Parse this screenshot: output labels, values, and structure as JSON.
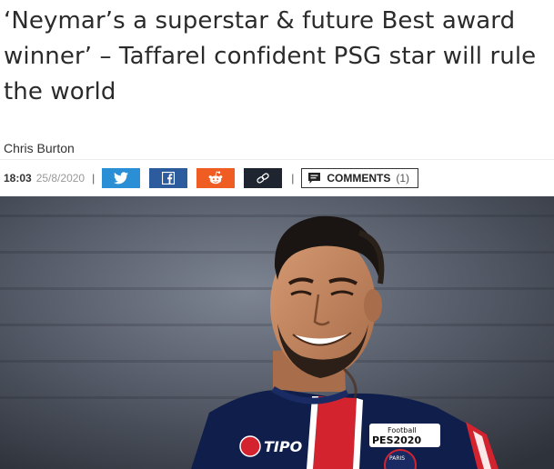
{
  "article": {
    "headline": "‘Neymar’s a superstar & future Best award winner’ – Taffarel confident PSG star will rule the world",
    "author": "Chris Burton",
    "time": "18:03",
    "date": "25/8/2020"
  },
  "share": {
    "separator": "|",
    "buttons": [
      {
        "icon": "twitter-bird-icon",
        "color": "#2b8fd6"
      },
      {
        "icon": "facebook-icon",
        "color": "#2d5c9e"
      },
      {
        "icon": "reddit-icon",
        "color": "#ef5d22"
      },
      {
        "icon": "link-icon",
        "color": "#1e2530"
      }
    ]
  },
  "comments": {
    "label": "COMMENTS",
    "count": "(1)",
    "icon": "comment-bubble-icon"
  },
  "hero": {
    "shirt_sponsor": "TIPO",
    "sleeve_badge_line1": "Football",
    "sleeve_badge_line2": "PES2020",
    "crest_text": "PARIS"
  }
}
